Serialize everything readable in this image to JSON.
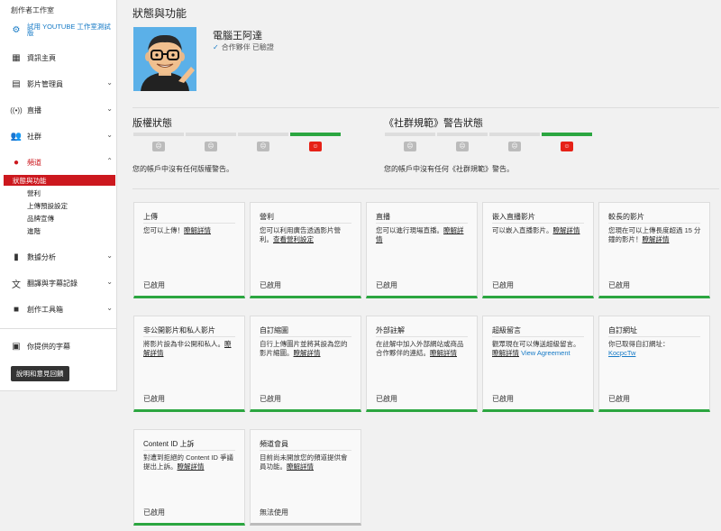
{
  "sidebar": {
    "studio_title": "創作者工作室",
    "beta_label": "試用 YOUTUBE 工作室測試版",
    "nav": [
      {
        "label": "資訊主頁",
        "icon": "dashboard-icon",
        "chevron": false
      },
      {
        "label": "影片管理員",
        "icon": "video-manager-icon",
        "chevron": true
      },
      {
        "label": "直播",
        "icon": "live-icon",
        "chevron": true
      },
      {
        "label": "社群",
        "icon": "community-icon",
        "chevron": true
      },
      {
        "label": "頻道",
        "icon": "channel-icon",
        "chevron": true
      }
    ],
    "channel_sub": [
      "狀態與功能",
      "營利",
      "上傳預設設定",
      "品牌宣傳",
      "進階"
    ],
    "nav2": [
      {
        "label": "數據分析",
        "icon": "analytics-icon"
      },
      {
        "label": "翻譯與字幕記錄",
        "icon": "translate-icon"
      },
      {
        "label": "創作工具箱",
        "icon": "create-icon"
      }
    ],
    "subtitles": "你提供的字幕",
    "help_button": "說明和意見回饋"
  },
  "main": {
    "title": "狀態與功能",
    "channel_name": "電腦王阿達",
    "channel_status": "合作夥伴 已驗證",
    "copyright": {
      "title": "版權狀態",
      "note": "您的帳戶中沒有任何版權警告。"
    },
    "guidelines": {
      "title": "《社群規範》警告狀態",
      "note": "您的帳戶中沒有任何《社群規範》警告。"
    },
    "strikes_active_index": 3,
    "learn_more": "瞭解詳情",
    "cards": [
      {
        "title": "上傳",
        "desc": "您可以上傳！",
        "link": "瞭解詳情",
        "status": "已啟用",
        "on": true
      },
      {
        "title": "營利",
        "desc": "您可以利用廣告透過影片營利。",
        "link": "查看營利設定",
        "status": "已啟用",
        "on": true
      },
      {
        "title": "直播",
        "desc": "您可以進行現場直播。",
        "link": "瞭解詳情",
        "status": "已啟用",
        "on": true
      },
      {
        "title": "嵌入直播影片",
        "desc": "可以嵌入直播影片。",
        "link": "瞭解詳情",
        "status": "已啟用",
        "on": true
      },
      {
        "title": "較長的影片",
        "desc": "您現在可以上傳長度超過 15 分鐘的影片！",
        "link": "瞭解詳情",
        "status": "已啟用",
        "on": true
      },
      {
        "title": "非公開影片和私人影片",
        "desc": "將影片設為非公開和私人。",
        "link": "瞭解詳情",
        "status": "已啟用",
        "on": true
      },
      {
        "title": "自訂縮圖",
        "desc": "自行上傳圖片並將其設為您的影片縮圖。",
        "link": "瞭解詳情",
        "status": "已啟用",
        "on": true
      },
      {
        "title": "外部註解",
        "desc": "在註解中加入外部網站或商品合作夥伴的連結。",
        "link": "瞭解詳情",
        "status": "已啟用",
        "on": true
      },
      {
        "title": "超級留言",
        "desc": "觀眾現在可以傳送超級留言。",
        "link": "瞭解詳情",
        "link2": "View Agreement",
        "status": "已啟用",
        "on": true
      },
      {
        "title": "自訂網址",
        "desc": "你已取得自訂網址：",
        "link": "KocpcTw",
        "status": "已啟用",
        "on": true
      },
      {
        "title": "Content ID 上訴",
        "desc": "對遭到拒絕的 Content ID 爭議提出上訴。",
        "link": "瞭解詳情",
        "status": "已啟用",
        "on": true
      },
      {
        "title": "頻道會員",
        "desc": "目前尚未開放您的頻道提供會員功能。",
        "link": "瞭解詳情",
        "status": "無法使用",
        "on": false
      }
    ]
  }
}
